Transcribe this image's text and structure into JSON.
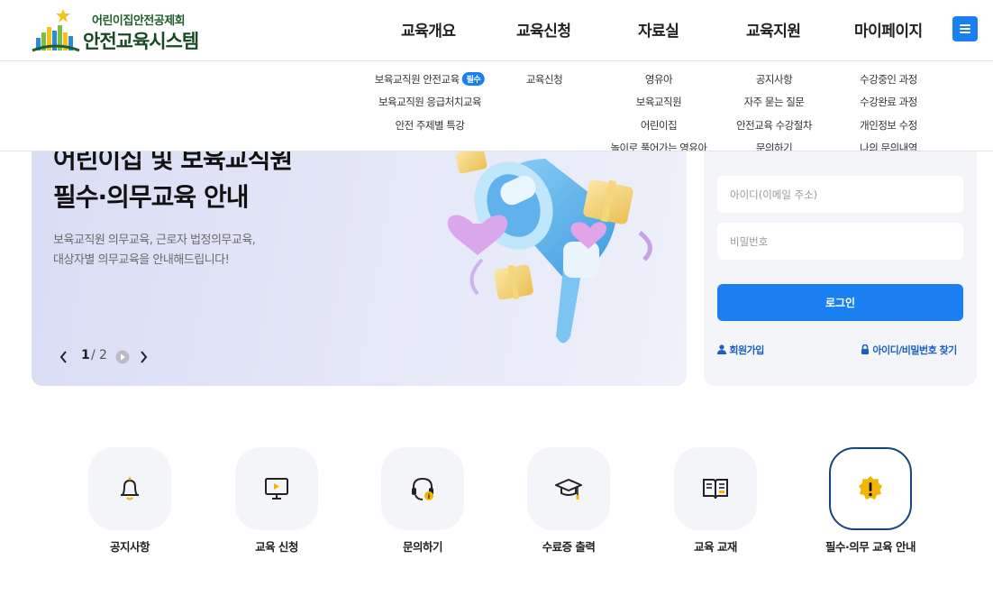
{
  "brand": {
    "subtitle": "어린이집안전공제회",
    "title": "안전교육시스템"
  },
  "nav": {
    "items": [
      "교육개요",
      "교육신청",
      "자료실",
      "교육지원",
      "마이페이지"
    ]
  },
  "dropdown": {
    "overview": [
      "보육교직원 안전교육",
      "보육교직원 응급처치교육",
      "안전 주제별 특강"
    ],
    "overview_badge": "필수",
    "apply": [
      "교육신청"
    ],
    "library": [
      "영유아",
      "보육교직원",
      "어린이집",
      "놀이로 풀어가는 영유아"
    ],
    "support": [
      "공지사항",
      "자주 묻는 질문",
      "안전교육 수강절차",
      "문의하기"
    ],
    "mypage": [
      "수강중인 과정",
      "수강완료 과정",
      "개인정보 수정",
      "나의 문의내역"
    ]
  },
  "hero": {
    "title_line1": "어린이집 및 보육교직원",
    "title_line2": "필수·의무교육 안내",
    "desc_line1": "보육교직원 의무교육, 근로자 법정의무교육,",
    "desc_line2": "대상자별 의무교육을 안내해드립니다!",
    "page_current": "1",
    "page_total": "2",
    "prev_icon": "chevron-left-icon",
    "next_icon": "chevron-right-icon",
    "play_icon": "play-icon"
  },
  "login": {
    "id_placeholder": "아이디(이메일 주소)",
    "pw_placeholder": "비밀번호",
    "button": "로그인",
    "signup": "회원가입",
    "find": "아이디/비밀번호 찾기"
  },
  "quick_links": [
    {
      "label": "공지사항",
      "icon": "bell-icon"
    },
    {
      "label": "교육 신청",
      "icon": "monitor-icon"
    },
    {
      "label": "문의하기",
      "icon": "headset-icon"
    },
    {
      "label": "수료증 출력",
      "icon": "graduation-cap-icon"
    },
    {
      "label": "교육 교재",
      "icon": "book-icon"
    },
    {
      "label": "필수·의무 교육 안내",
      "icon": "alert-icon"
    }
  ],
  "colors": {
    "primary": "#1a7ff0",
    "active_border": "#17457d",
    "brand_green": "#174a24"
  }
}
